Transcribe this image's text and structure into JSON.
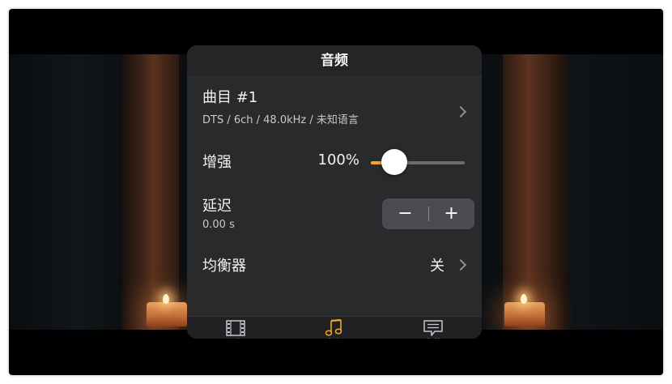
{
  "panel": {
    "title": "音频"
  },
  "track": {
    "title": "曲目 #1",
    "detail": "DTS / 6ch / 48.0kHz / 未知语言"
  },
  "boost": {
    "label": "增强",
    "value_text": "100%",
    "level_fraction": 0.25
  },
  "delay": {
    "label": "延迟",
    "value": "0.00 s",
    "minus_symbol": "−",
    "plus_symbol": "+"
  },
  "equalizer": {
    "label": "均衡器",
    "value": "关"
  },
  "tabs": [
    {
      "label": "视频",
      "icon": "film-icon",
      "active": false
    },
    {
      "label": "音频",
      "icon": "music-note-icon",
      "active": true
    },
    {
      "label": "字幕",
      "icon": "subtitle-bubble-icon",
      "active": false
    }
  ],
  "colors": {
    "accent": "#f5a623",
    "panel_background": "#2c2c2e",
    "inactive_tab": "#c7c7cc"
  }
}
